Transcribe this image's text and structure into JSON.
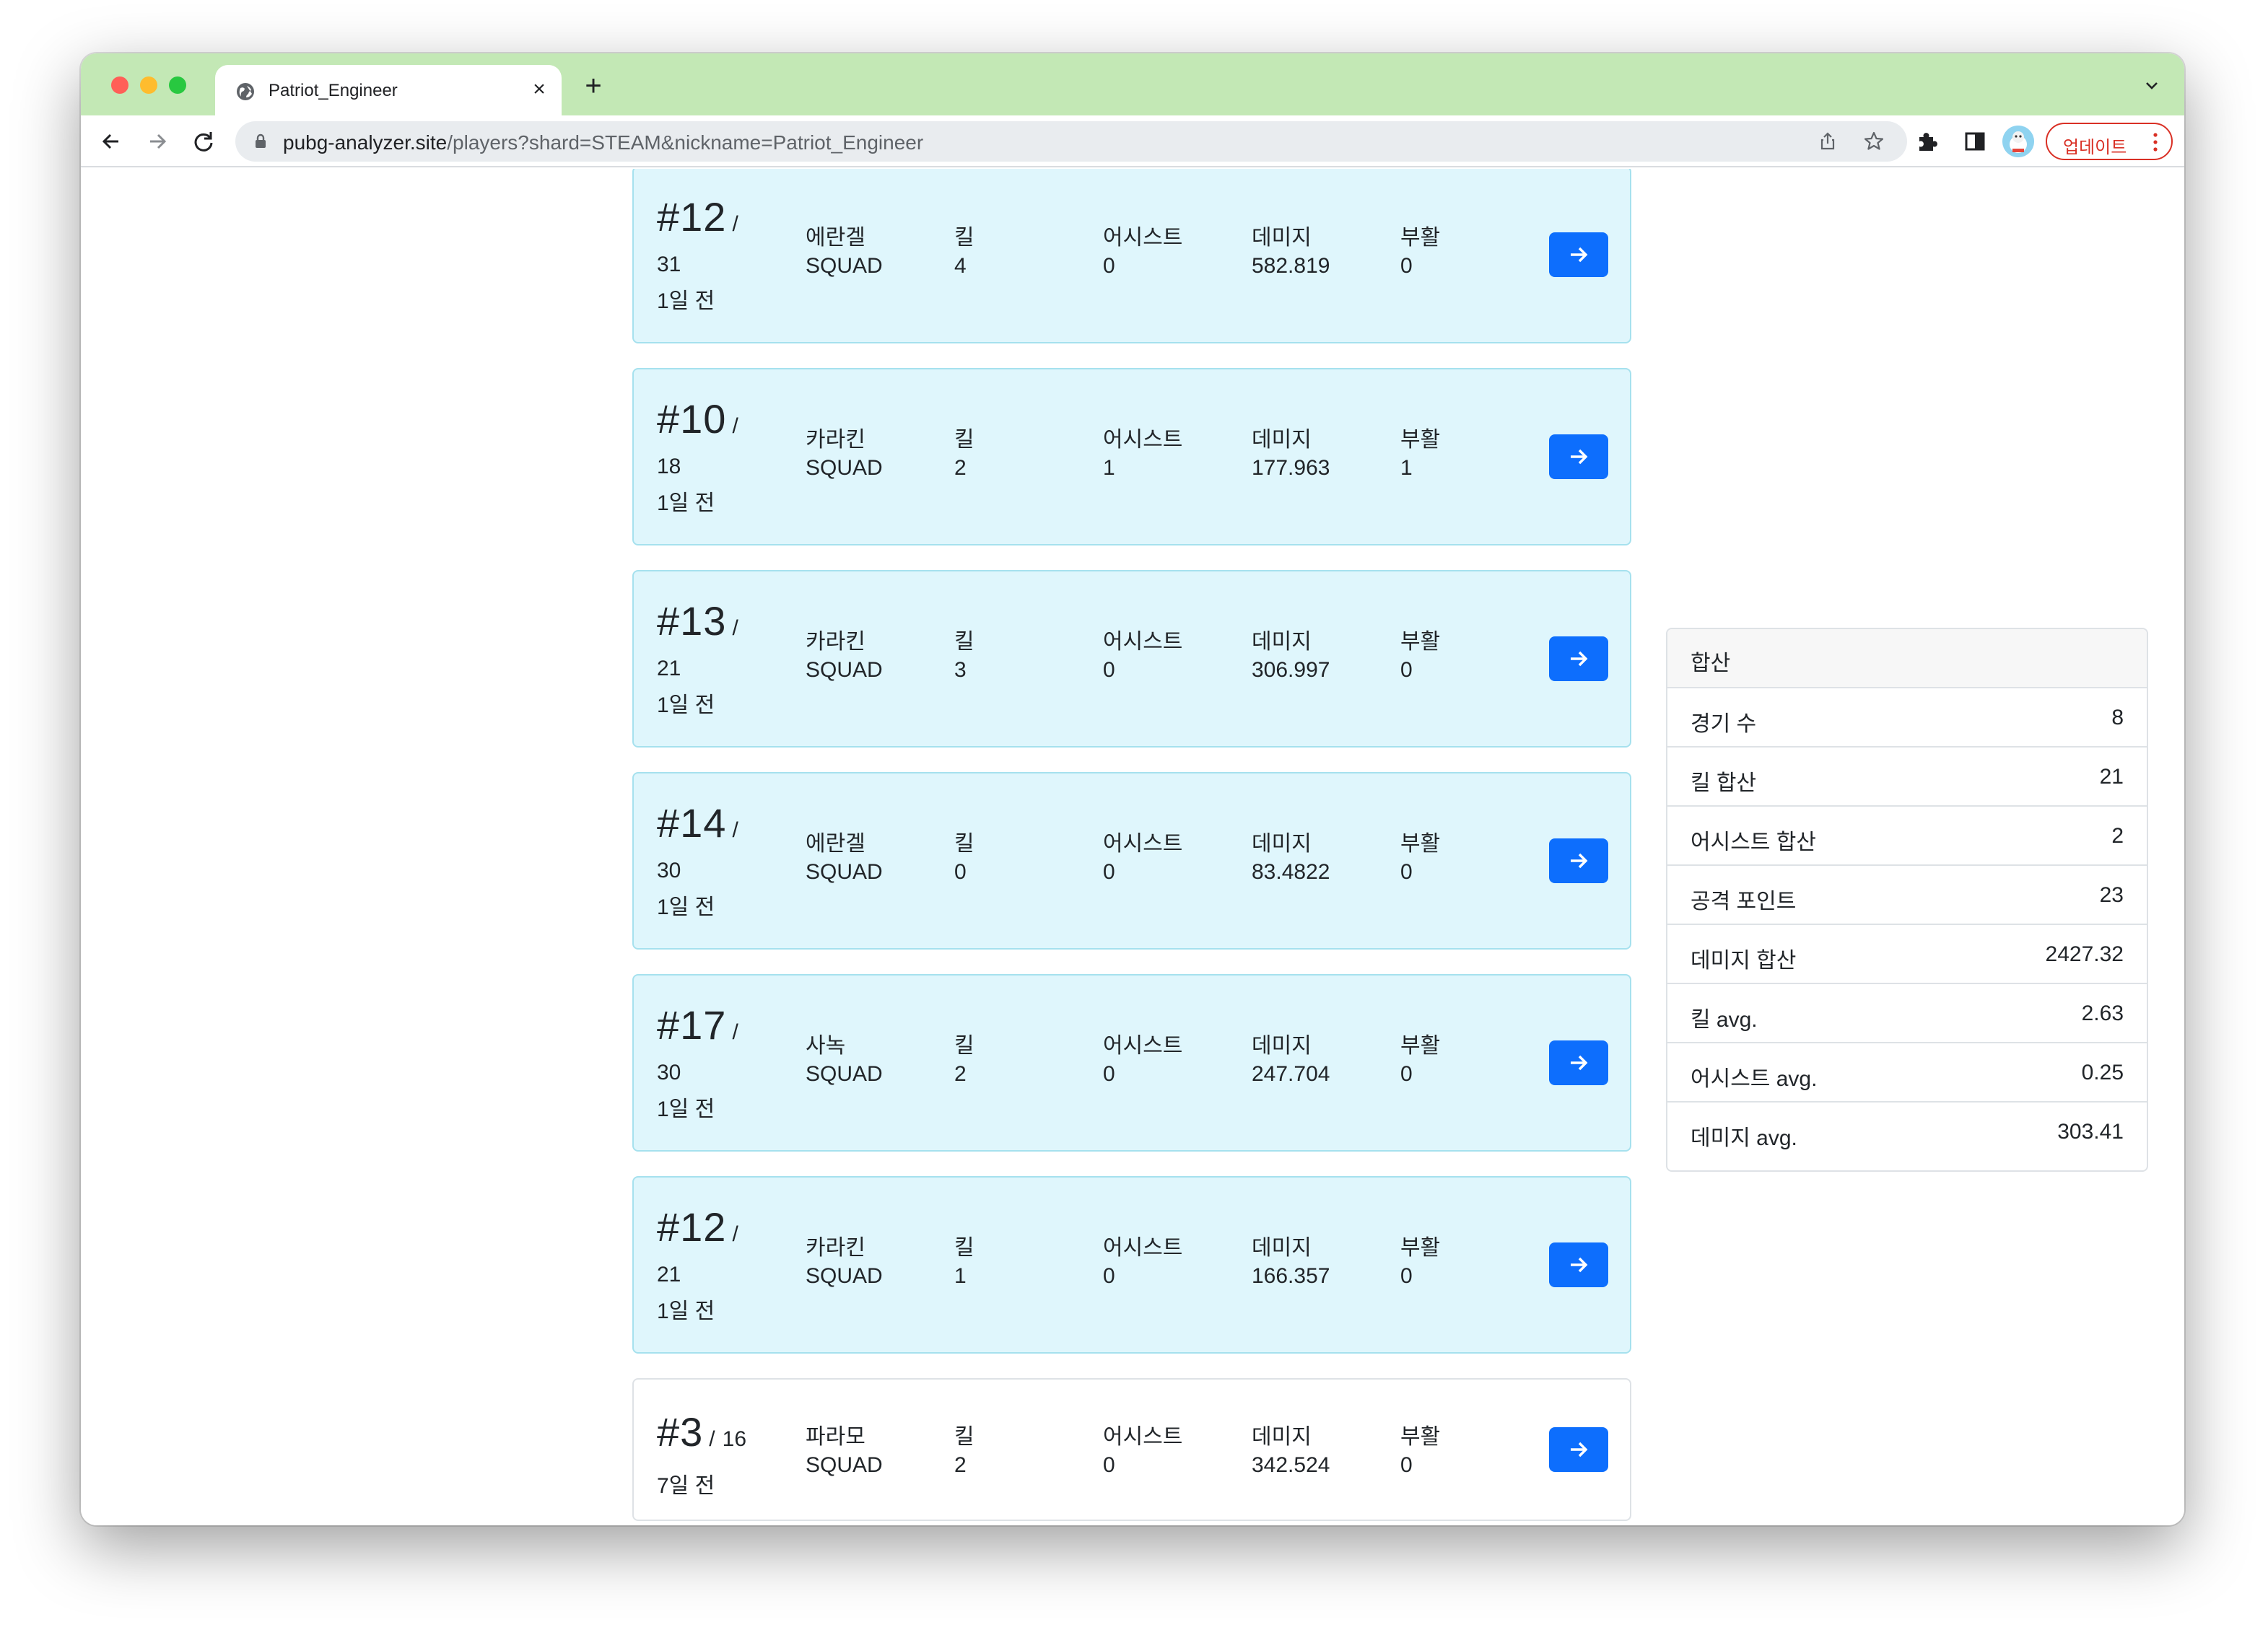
{
  "browser": {
    "tab_title": "Patriot_Engineer",
    "url_host": "pubg-analyzer.site",
    "url_path": "/players?shard=STEAM&nickname=Patriot_Engineer",
    "update_label": "업데이트"
  },
  "headers": {
    "kill": "킬",
    "assist": "어시스트",
    "damage": "데미지",
    "revive": "부활",
    "slash": "/"
  },
  "matches": [
    {
      "rank": "#12",
      "total": "31",
      "ago": "1일 전",
      "map": "에란겔",
      "mode": "SQUAD",
      "kills": "4",
      "assists": "0",
      "damage": "582.819",
      "revives": "0"
    },
    {
      "rank": "#10",
      "total": "18",
      "ago": "1일 전",
      "map": "카라킨",
      "mode": "SQUAD",
      "kills": "2",
      "assists": "1",
      "damage": "177.963",
      "revives": "1"
    },
    {
      "rank": "#13",
      "total": "21",
      "ago": "1일 전",
      "map": "카라킨",
      "mode": "SQUAD",
      "kills": "3",
      "assists": "0",
      "damage": "306.997",
      "revives": "0"
    },
    {
      "rank": "#14",
      "total": "30",
      "ago": "1일 전",
      "map": "에란겔",
      "mode": "SQUAD",
      "kills": "0",
      "assists": "0",
      "damage": "83.4822",
      "revives": "0"
    },
    {
      "rank": "#17",
      "total": "30",
      "ago": "1일 전",
      "map": "사녹",
      "mode": "SQUAD",
      "kills": "2",
      "assists": "0",
      "damage": "247.704",
      "revives": "0"
    },
    {
      "rank": "#12",
      "total": "21",
      "ago": "1일 전",
      "map": "카라킨",
      "mode": "SQUAD",
      "kills": "1",
      "assists": "0",
      "damage": "166.357",
      "revives": "0"
    },
    {
      "rank": "#3",
      "total": "16",
      "ago": "7일 전",
      "map": "파라모",
      "mode": "SQUAD",
      "kills": "2",
      "assists": "0",
      "damage": "342.524",
      "revives": "0"
    }
  ],
  "summary": {
    "title": "합산",
    "rows": [
      {
        "label": "경기 수",
        "value": "8"
      },
      {
        "label": "킬 합산",
        "value": "21"
      },
      {
        "label": "어시스트 합산",
        "value": "2"
      },
      {
        "label": "공격 포인트",
        "value": "23"
      },
      {
        "label": "데미지 합산",
        "value": "2427.32"
      },
      {
        "label": "킬 avg.",
        "value": "2.63"
      },
      {
        "label": "어시스트 avg.",
        "value": "0.25"
      },
      {
        "label": "데미지 avg.",
        "value": "303.41"
      }
    ]
  },
  "colors": {
    "titlebar": "#c3e8b5",
    "card_bg": "#dff6fc",
    "card_border": "#a6e1ee",
    "primary_button": "#0d6efd",
    "update_red": "#d93025"
  }
}
